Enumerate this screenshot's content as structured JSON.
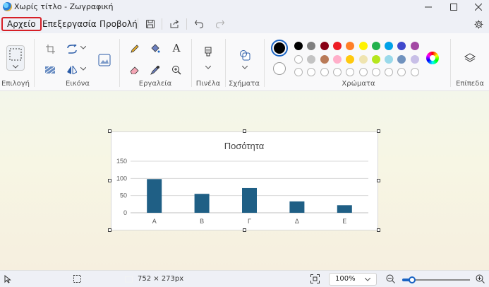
{
  "window": {
    "title": "Χωρίς τίτλο - Ζωγραφική",
    "minimize_icon": "minimize-icon",
    "maximize_icon": "maximize-icon",
    "close_icon": "close-icon"
  },
  "menu": {
    "file": "Αρχείο",
    "edit": "Επεξεργασία",
    "view": "Προβολή"
  },
  "ribbon": {
    "groups": {
      "selection": "Επιλογή",
      "image": "Εικόνα",
      "tools": "Εργαλεία",
      "brushes": "Πινέλα",
      "shapes": "Σχήματα",
      "colors": "Χρώματα",
      "layers": "Επίπεδα"
    },
    "text_tool": "A"
  },
  "colors": {
    "primary": "#000000",
    "secondary": "#ffffff",
    "palette_row1": [
      "#000000",
      "#7f7f7f",
      "#880015",
      "#ed1c24",
      "#ff7f27",
      "#fff200",
      "#22b14c",
      "#00a2e8",
      "#3f48cc",
      "#a349a4"
    ],
    "palette_row2": [
      "#ffffff",
      "#c3c3c3",
      "#b97a57",
      "#ffaec9",
      "#ffc90e",
      "#efe4b0",
      "#b5e61d",
      "#99d9ea",
      "#7092be",
      "#c8bfe7"
    ]
  },
  "chart_data": {
    "type": "bar",
    "title": "Ποσότητα",
    "categories": [
      "Α",
      "Β",
      "Γ",
      "Δ",
      "Ε"
    ],
    "values": [
      98,
      55,
      72,
      33,
      22
    ],
    "ylim": [
      0,
      150
    ],
    "yticks": [
      "150",
      "100",
      "50",
      "0"
    ],
    "bar_color": "#1f5f85",
    "grid": true
  },
  "status": {
    "canvas_size": "752 × 273px",
    "zoom": "100%"
  }
}
